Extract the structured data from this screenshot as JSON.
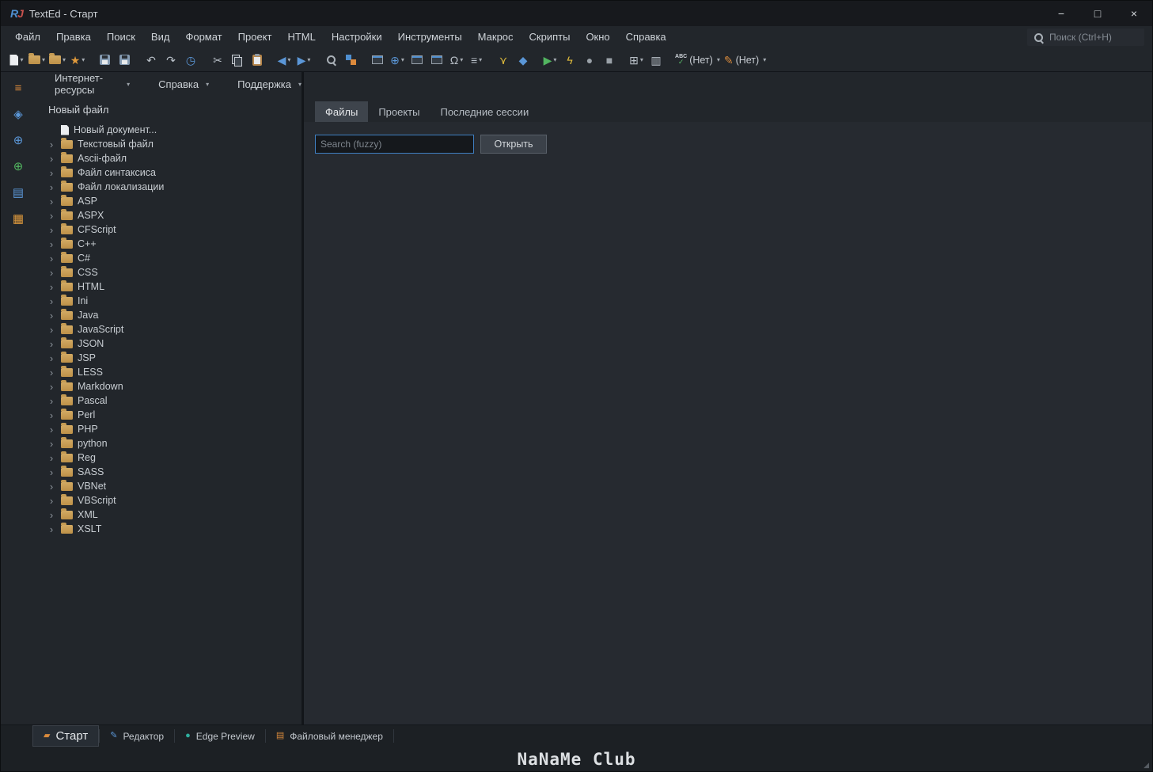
{
  "window": {
    "logo_r": "R",
    "logo_j": "J",
    "title": "TextEd - Старт",
    "minimize": "−",
    "maximize": "□",
    "close": "×"
  },
  "menubar": {
    "items": [
      "Файл",
      "Правка",
      "Поиск",
      "Вид",
      "Формат",
      "Проект",
      "HTML",
      "Настройки",
      "Инструменты",
      "Макрос",
      "Скрипты",
      "Окно",
      "Справка"
    ],
    "search_placeholder": "Поиск (Ctrl+H)"
  },
  "toolbar": {
    "abc": "ABC",
    "spell_none": "(Нет)",
    "style_none": "(Нет)"
  },
  "icons": {
    "caret": "▾",
    "chevron": "›",
    "star": "★",
    "undo": "↶",
    "redo": "↷",
    "history": "◷",
    "cut": "✂",
    "back": "◀",
    "forward": "▶",
    "globe": "⊕",
    "omega": "Ω",
    "text_lines": "≡",
    "branch": "⋎",
    "puzzle": "◆",
    "play": "▶",
    "lightning": "ϟ",
    "record": "●",
    "stop": "■",
    "grid": "⊞",
    "layout": "▥",
    "pencil": "✎",
    "check": "✓",
    "strip_list": "≡",
    "strip_palette": "◈",
    "strip_globe": "⊕",
    "strip_globe2": "⊕",
    "strip_chart": "▤",
    "strip_notes": "▦",
    "start_mark": "▰",
    "edge_dot": "●",
    "files": "▤",
    "grip": "◢"
  },
  "resourcebar": {
    "items": [
      "Интернет-ресурсы",
      "Справка",
      "Поддержка"
    ]
  },
  "tree": {
    "header": "Новый файл",
    "new_document": "Новый документ...",
    "folders": [
      "Текстовый файл",
      "Ascii-файл",
      "Файл синтаксиса",
      "Файл локализации",
      "ASP",
      "ASPX",
      "CFScript",
      "C++",
      "C#",
      "CSS",
      "HTML",
      "Ini",
      "Java",
      "JavaScript",
      "JSON",
      "JSP",
      "LESS",
      "Markdown",
      "Pascal",
      "Perl",
      "PHP",
      "python",
      "Reg",
      "SASS",
      "VBNet",
      "VBScript",
      "XML",
      "XSLT"
    ]
  },
  "main": {
    "tabs": [
      "Файлы",
      "Проекты",
      "Последние сессии"
    ],
    "search_placeholder": "Search (fuzzy)",
    "open_button": "Открыть"
  },
  "statusbar": {
    "tabs": [
      "Старт",
      "Редактор",
      "Edge Preview",
      "Файловый менеджер"
    ]
  },
  "watermark": "NaNaMe Club"
}
